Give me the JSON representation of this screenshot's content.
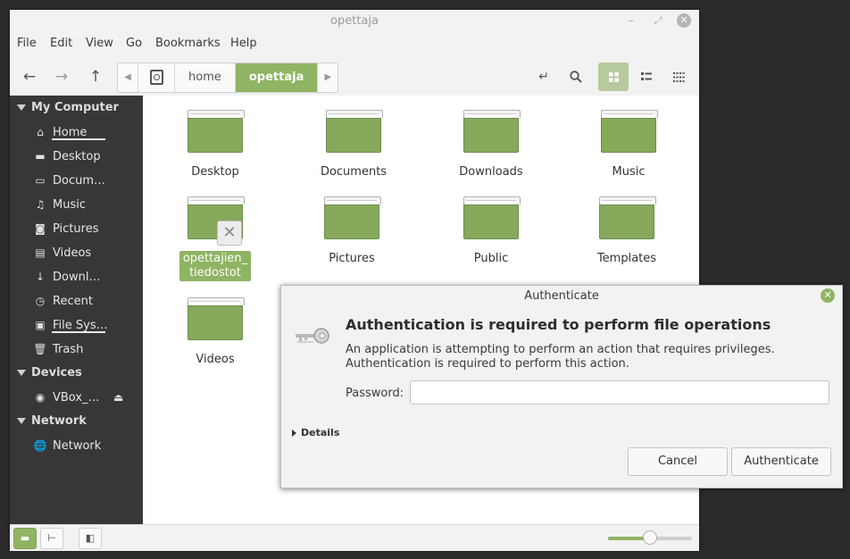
{
  "window": {
    "title": "opettaja",
    "controls": {
      "minimize": "–",
      "maximize": "⤢",
      "close": "✕"
    }
  },
  "menubar": [
    "File",
    "Edit",
    "View",
    "Go",
    "Bookmarks",
    "Help"
  ],
  "toolbar": {
    "icons": [
      "back-arrow-icon",
      "forward-arrow-icon",
      "up-arrow-icon",
      "path-left-icon",
      "filesystem-icon",
      "path-right-icon",
      "toggle-location-icon",
      "search-icon",
      "icon-view-icon",
      "list-view-icon",
      "compact-view-icon"
    ],
    "path": [
      "home",
      "opettaja"
    ],
    "active_view": "icon-view"
  },
  "sidebar": {
    "sections": [
      {
        "title": "My Computer",
        "items": [
          "Home",
          "Desktop",
          "Docum…",
          "Music",
          "Pictures",
          "Videos",
          "Downl…",
          "Recent",
          "File Sys…",
          "Trash"
        ]
      },
      {
        "title": "Devices",
        "items": [
          "VBox_…"
        ]
      },
      {
        "title": "Network",
        "items": [
          "Network"
        ]
      }
    ],
    "icons": [
      "home-icon",
      "desktop-icon",
      "documents-icon",
      "music-icon",
      "camera-icon",
      "film-icon",
      "download-icon",
      "clock-icon",
      "drive-icon",
      "trash-icon",
      "disc-icon",
      "network-icon"
    ],
    "eject_icon": "eject-icon"
  },
  "files": [
    {
      "name": "Desktop"
    },
    {
      "name": "Documents"
    },
    {
      "name": "Downloads"
    },
    {
      "name": "Music"
    },
    {
      "name": "opettajien_\ntiedostot",
      "line1": "opettajien_",
      "line2": "tiedostot",
      "selected": true,
      "emblem": "no-access-icon"
    },
    {
      "name": "Pictures"
    },
    {
      "name": "Public"
    },
    {
      "name": "Templates"
    },
    {
      "name": "Videos"
    }
  ],
  "statusbar": {
    "buttons": [
      "places-icon",
      "tree-icon",
      "sidebar-toggle-icon"
    ],
    "zoom_level": 0.5
  },
  "dialog": {
    "title": "Authenticate",
    "heading": "Authentication is required to perform file operations",
    "body": "An application is attempting to perform an action that requires privileges. Authentication is required to perform this action.",
    "password_label": "Password:",
    "password_value": "",
    "details_label": "Details",
    "cancel_label": "Cancel",
    "authenticate_label": "Authenticate",
    "icon": "keys-icon"
  },
  "colors": {
    "accent": "#8fb463",
    "folder": "#86a95c",
    "sidebar": "#373737"
  }
}
